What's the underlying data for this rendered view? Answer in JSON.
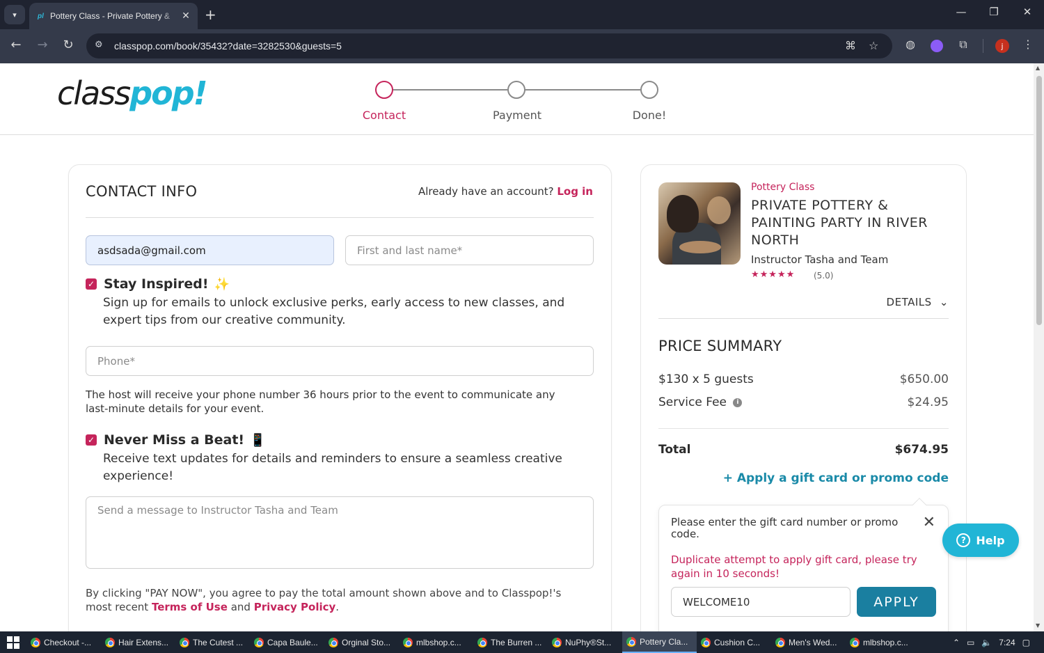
{
  "browser": {
    "tab_favicon": "pl",
    "tab_title": "Pottery Class - Private Pottery &",
    "url": "classpop.com/book/35432?date=3282530&guests=5"
  },
  "header": {
    "logo_part1": "class",
    "logo_part2": "pop!",
    "steps": [
      {
        "label": "Contact",
        "state": "active"
      },
      {
        "label": "Payment",
        "state": "inactive"
      },
      {
        "label": "Done!",
        "state": "inactive"
      }
    ]
  },
  "contact": {
    "title": "CONTACT INFO",
    "account_prompt": "Already have an account?",
    "login_label": "Log in",
    "email_value": "asdsada@gmail.com",
    "name_placeholder": "First and last name*",
    "stay_inspired_title": "Stay Inspired!",
    "stay_inspired_desc": "Sign up for emails to unlock exclusive perks, early access to new classes, and expert tips from our creative community.",
    "phone_placeholder": "Phone*",
    "phone_note": "The host will receive your phone number 36 hours prior to the event to communicate any last-minute details for your event.",
    "never_miss_title": "Never Miss a Beat!",
    "never_miss_desc": "Receive text updates for details and reminders to ensure a seamless creative experience!",
    "message_placeholder": "Send a message to Instructor Tasha and Team",
    "terms_prefix": "By clicking \"PAY NOW\", you agree to pay the total amount shown above and to Classpop!'s most recent",
    "terms_link": "Terms of Use",
    "terms_and": "and",
    "privacy_link": "Privacy Policy",
    "terms_suffix": "."
  },
  "summary": {
    "category": "Pottery Class",
    "class_name": "PRIVATE POTTERY & PAINTING PARTY IN RIVER NORTH",
    "instructor": "Instructor Tasha and Team",
    "stars": "★★★★★",
    "rating": "(5.0)",
    "details_label": "DETAILS",
    "price_title": "PRICE SUMMARY",
    "line_items": [
      {
        "label": "$130 x 5 guests",
        "amount": "$650.00"
      },
      {
        "label": "Service Fee",
        "amount": "$24.95"
      }
    ],
    "total_label": "Total",
    "total_amount": "$674.95",
    "promo_link": "+ Apply a gift card or promo code",
    "promo_prompt": "Please enter the gift card number or promo code.",
    "promo_error": "Duplicate attempt to apply gift card, please try again in 10 seconds!",
    "promo_value": "WELCOME10",
    "apply_label": "APPLY"
  },
  "help": {
    "label": "Help"
  },
  "taskbar": {
    "items": [
      {
        "label": "Checkout -..."
      },
      {
        "label": "Hair Extens..."
      },
      {
        "label": "The Cutest ..."
      },
      {
        "label": "Capa Baule..."
      },
      {
        "label": "Orginal Sto..."
      },
      {
        "label": "mlbshop.c..."
      },
      {
        "label": "The Burren ..."
      },
      {
        "label": "NuPhy®St..."
      },
      {
        "label": "Pottery Cla..."
      },
      {
        "label": "Cushion C..."
      },
      {
        "label": "Men's Wed..."
      },
      {
        "label": "mlbshop.c..."
      }
    ],
    "time": "7:24"
  },
  "colors": {
    "brand_pink": "#c5245b",
    "brand_cyan": "#21b5d6",
    "apply_teal": "#1a7fa0"
  }
}
